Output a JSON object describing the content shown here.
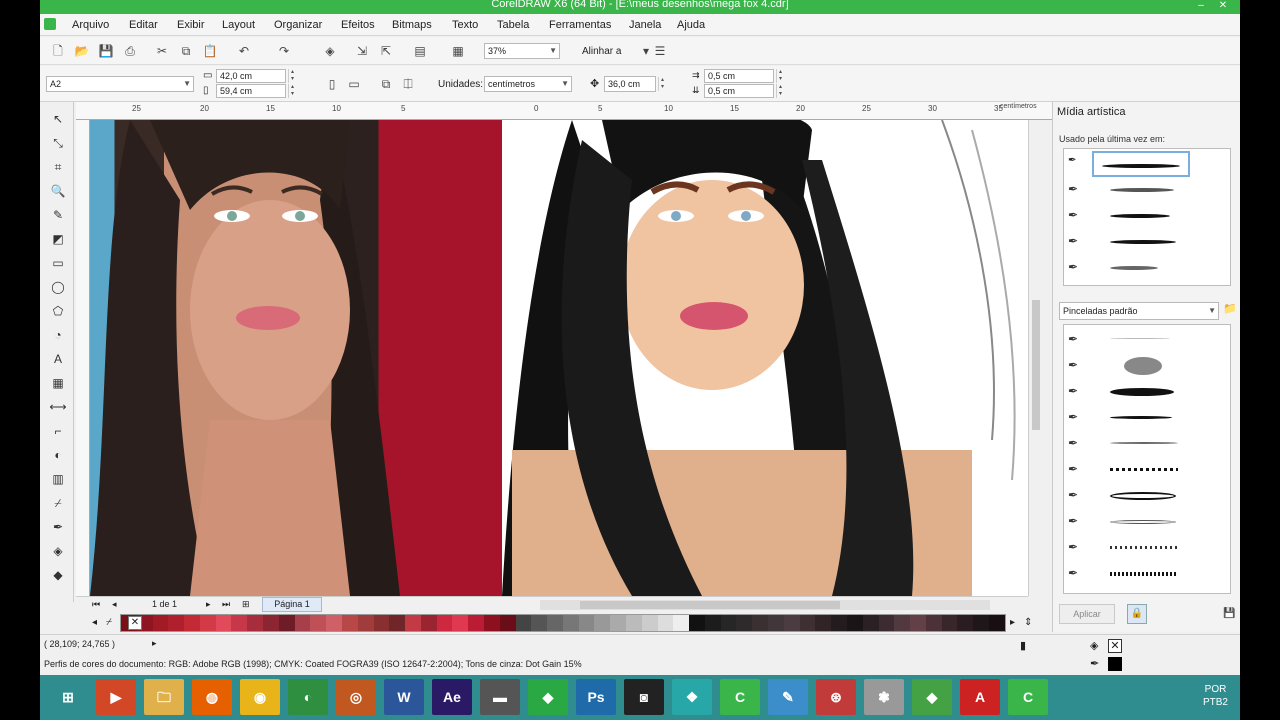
{
  "window": {
    "title": "CorelDRAW X6 (64 Bit) - [E:\\meus desenhos\\mega fox 4.cdr]"
  },
  "menu": [
    "Arquivo",
    "Editar",
    "Exibir",
    "Layout",
    "Organizar",
    "Efeitos",
    "Bitmaps",
    "Texto",
    "Tabela",
    "Ferramentas",
    "Janela",
    "Ajuda"
  ],
  "standard_toolbar": {
    "zoom": "37%",
    "align_label": "Alinhar a"
  },
  "property_bar": {
    "page_size": "A2",
    "width": "42,0 cm",
    "height": "59,4 cm",
    "units_label": "Unidades:",
    "units_value": "centímetros",
    "nudge": "36,0 cm",
    "dup_x": "0,5 cm",
    "dup_y": "0,5 cm"
  },
  "ruler": {
    "ticks": [
      "25",
      "20",
      "15",
      "10",
      "5",
      "0",
      "5",
      "10",
      "15",
      "20",
      "25",
      "30",
      "35"
    ],
    "unit": "centímetros"
  },
  "docker": {
    "title": "Mídia artística",
    "recent_label": "Usado pela última vez em:",
    "preset_select": "Pinceladas padrão",
    "apply_label": "Aplicar"
  },
  "page_nav": {
    "counter": "1 de 1",
    "page_tab": "Página 1"
  },
  "status": {
    "coords": "( 28,109; 24,765 )",
    "profile": "Perfis de cores do documento: RGB: Adobe RGB (1998); CMYK: Coated FOGRA39 (ISO 12647-2:2004); Tons de cinza: Dot Gain 15%"
  },
  "palette": [
    "#7a0f18",
    "#8e1521",
    "#a01b26",
    "#b0202c",
    "#c42a36",
    "#d33a48",
    "#e04a5a",
    "#c7374a",
    "#a82d3c",
    "#8c2532",
    "#6e1c27",
    "#a5404a",
    "#c05058",
    "#d06068",
    "#b84848",
    "#a03c3c",
    "#882f30",
    "#702628",
    "#c23a44",
    "#9a2430",
    "#ce2840",
    "#e03850",
    "#b91c34",
    "#8d1020",
    "#6a0d18",
    "#444444",
    "#555555",
    "#666666",
    "#777777",
    "#888888",
    "#999999",
    "#aaaaaa",
    "#bbbbbb",
    "#cccccc",
    "#dddddd",
    "#eeeeee",
    "#111111",
    "#1c1c1c",
    "#262626",
    "#2e2a2b",
    "#3a3032",
    "#41363a",
    "#4a3c40",
    "#3e2f33",
    "#302427",
    "#241b1e",
    "#1a1416",
    "#2b2024",
    "#3c2c31",
    "#52383f",
    "#634048",
    "#4d3138",
    "#38262b",
    "#2a1d21",
    "#1f161a",
    "#170f12"
  ],
  "taskbar": {
    "apps": [
      "Start",
      "Media",
      "Explorer",
      "Firefox",
      "Chrome",
      "Browser",
      "Manager",
      "Word",
      "After Effects",
      "Hardware",
      "CorelDRAW",
      "Photoshop",
      "Capture",
      "Files",
      "CorelDRAW X6",
      "Paint",
      "Game",
      "Bio",
      "Illustrator",
      "Acrobat",
      "CorelDRAW"
    ],
    "lang_1": "POR",
    "lang_2": "PTB2"
  }
}
